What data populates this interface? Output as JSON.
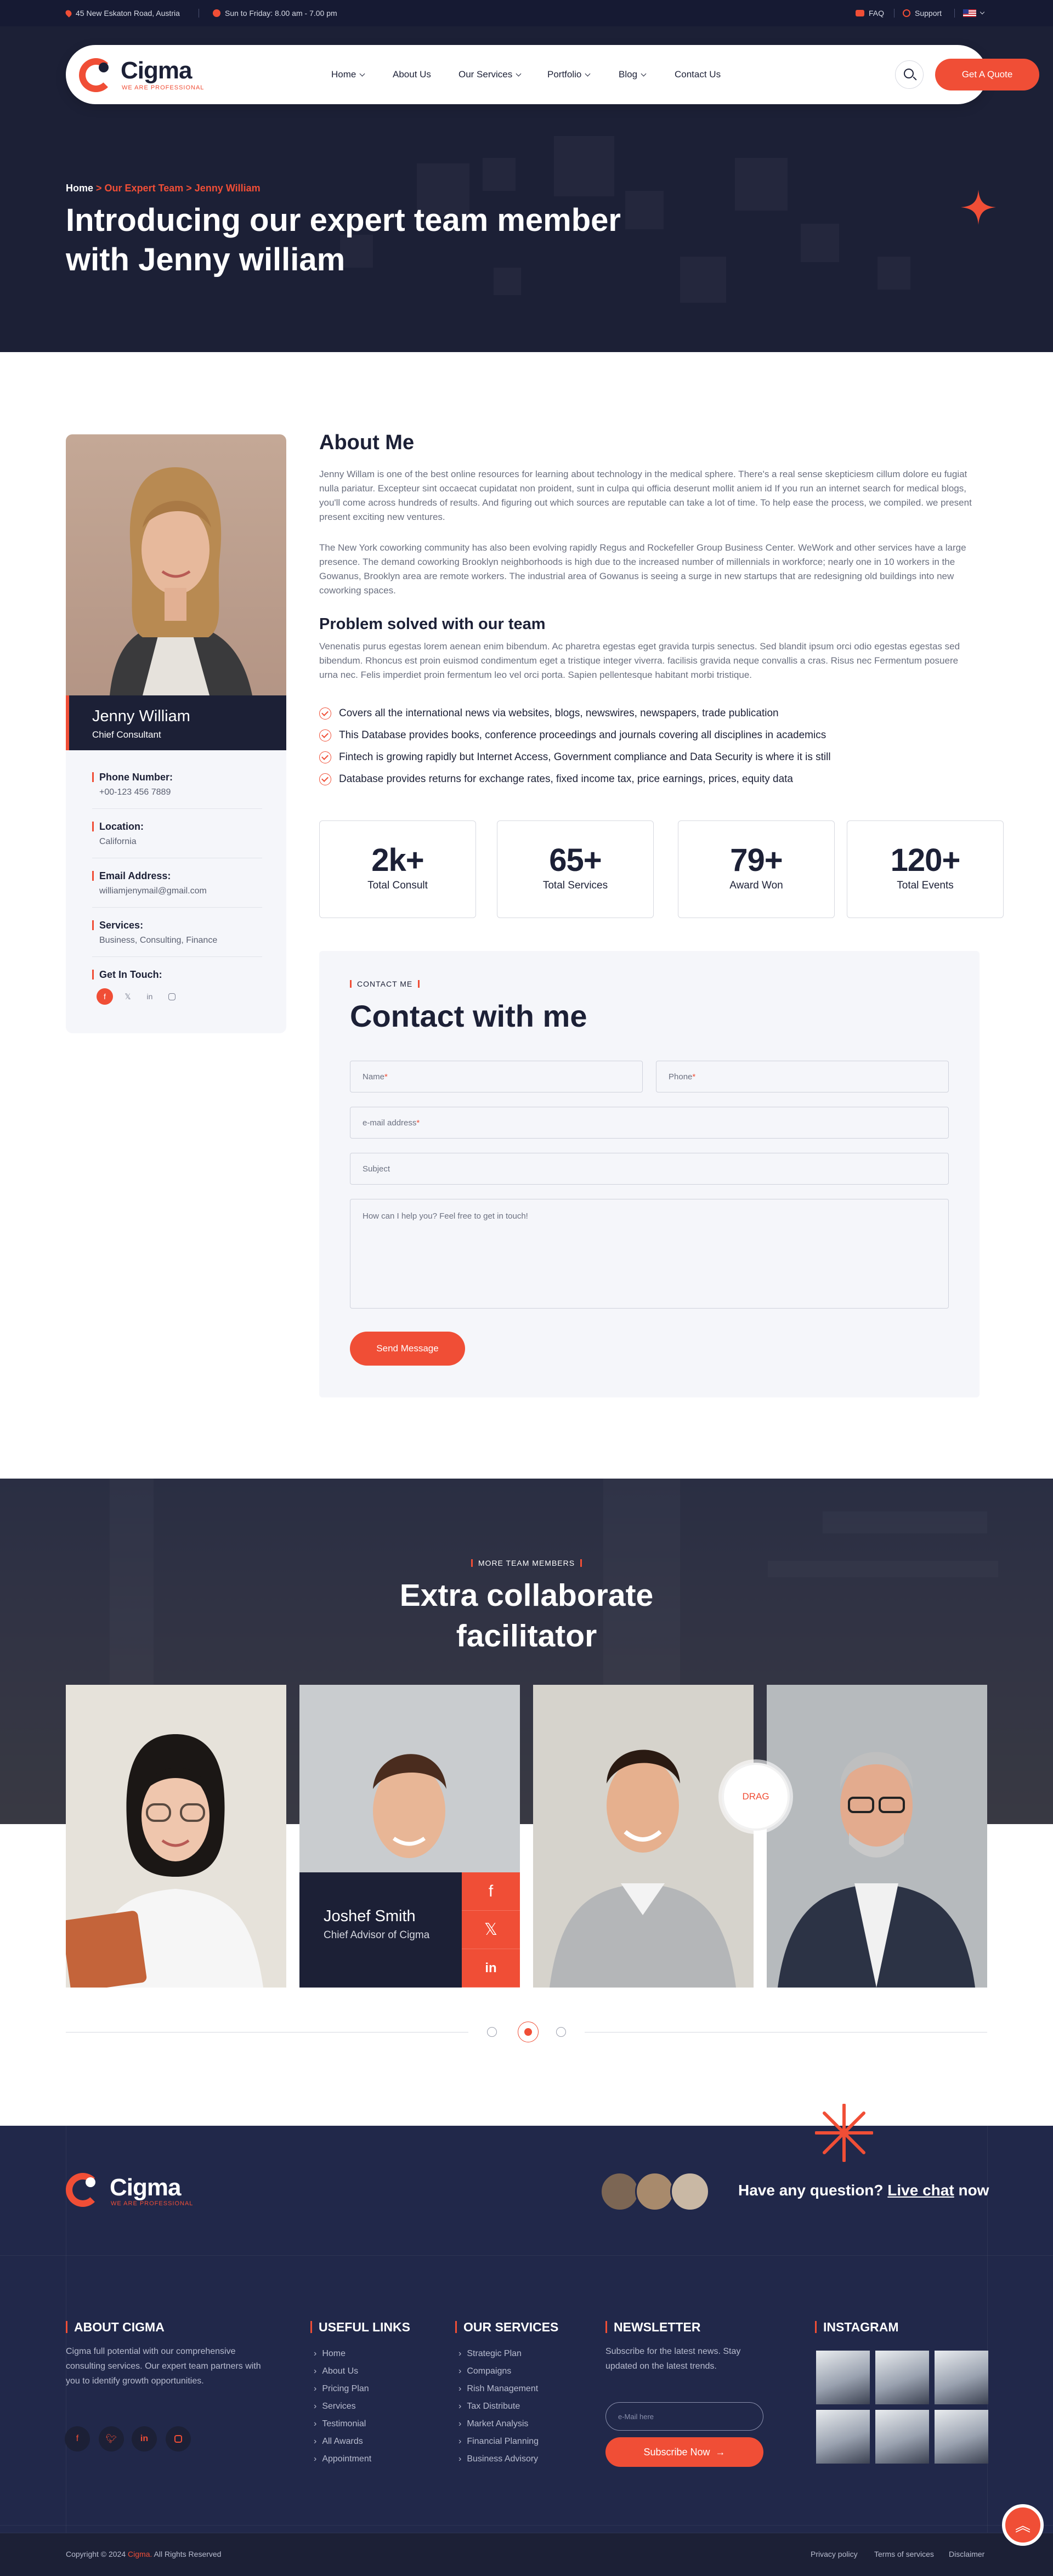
{
  "topbar": {
    "address": "45 New Eskaton Road, Austria",
    "hours": "Sun to Friday: 8.00 am - 7.00 pm",
    "faq": "FAQ",
    "support": "Support"
  },
  "header": {
    "brand": "Cigma",
    "tagline": "WE ARE PROFESSIONAL",
    "menu": [
      {
        "label": "Home",
        "has_dropdown": true
      },
      {
        "label": "About Us",
        "has_dropdown": false
      },
      {
        "label": "Our Services",
        "has_dropdown": true
      },
      {
        "label": "Portfolio",
        "has_dropdown": true
      },
      {
        "label": "Blog",
        "has_dropdown": true
      },
      {
        "label": "Contact Us",
        "has_dropdown": false
      }
    ],
    "cta": "Get A Quote"
  },
  "hero": {
    "breadcrumb": [
      "Home",
      "Our Expert Team",
      "Jenny William"
    ],
    "title_line1": "Introducing our expert team member",
    "title_line2": "with Jenny william"
  },
  "profile": {
    "name": "Jenny William",
    "role": "Chief Consultant",
    "info": [
      {
        "label": "Phone Number:",
        "value": "+00-123 456 7889"
      },
      {
        "label": "Location:",
        "value": "California"
      },
      {
        "label": "Email Address:",
        "value": "williamjenymail@gmail.com"
      },
      {
        "label": "Services:",
        "value": "Business, Consulting, Finance"
      }
    ],
    "get_in_touch": "Get In Touch:",
    "socials": [
      "facebook-icon",
      "x-icon",
      "linkedin-icon",
      "instagram-icon"
    ]
  },
  "about": {
    "heading": "About Me",
    "p1": "Jenny Willam is one of the best online resources for learning about technology in the medical sphere. There's a real sense skepticiesm cillum dolore eu fugiat nulla pariatur. Excepteur sint occaecat cupidatat non proident, sunt in culpa qui officia deserunt mollit aniem id If you run an internet search for medical blogs, you'll come across hundreds of results. And figuring out which sources are reputable can take a lot of time. To help ease the process, we compiled. we present present exciting new ventures.",
    "p2": "The New York coworking community has also been evolving rapidly Regus and Rockefeller Group Business Center. WeWork and other services have a large presence. The demand coworking Brooklyn neighborhoods is high due to the increased number of millennials in workforce; nearly one in 10 workers in the Gowanus, Brooklyn area are remote workers. The industrial area of Gowanus is seeing a surge in new startups that are redesigning old buildings into new coworking spaces.",
    "problem_heading": "Problem solved with our team",
    "p3": "Venenatis purus egestas lorem aenean enim bibendum. Ac pharetra egestas eget gravida turpis senectus. Sed blandit ipsum orci odio egestas egestas sed bibendum. Rhoncus est proin euismod condimentum eget a tristique integer viverra. facilisis gravida neque convallis a cras. Risus nec Fermentum posuere urna nec. Felis imperdiet proin fermentum leo vel orci porta. Sapien pellentesque habitant morbi tristique.",
    "checks": [
      "Covers all the international news via websites, blogs, newswires, newspapers, trade publication",
      "This Database provides books, conference proceedings and journals covering all disciplines in academics",
      "Fintech is growing rapidly but Internet Access, Government compliance and Data Security is where it is still",
      "Database provides returns for exchange rates, fixed income tax, price earnings, prices, equity data"
    ]
  },
  "stats": [
    {
      "value": "2k+",
      "label": "Total Consult"
    },
    {
      "value": "65+",
      "label": "Total Services"
    },
    {
      "value": "79+",
      "label": "Award Won"
    },
    {
      "value": "120+",
      "label": "Total Events"
    }
  ],
  "contact": {
    "tag": "CONTACT ME",
    "title": "Contact with me",
    "name_ph": "Name",
    "phone_ph": "Phone",
    "email_ph": "e-mail address",
    "subject_ph": "Subject",
    "message_ph": "How can I help you? Feel free to get in touch!",
    "required_mark": "*",
    "submit": "Send Message"
  },
  "team": {
    "tag": "MORE TEAM MEMBERS",
    "title_line1": "Extra collaborate",
    "title_line2": "facilitator",
    "featured_name": "Joshef Smith",
    "featured_role": "Chief Advisor of Cigma",
    "drag": "DRAG"
  },
  "footer": {
    "brand": "Cigma",
    "tagline": "WE ARE PROFESSIONAL",
    "question_text": "Have any question?",
    "live_chat": "Live chat",
    "question_tail": "now",
    "about_heading": "ABOUT CIGMA",
    "about_text": "Cigma full potential with our comprehensive consulting services. Our expert team partners with you to identify growth opportunities.",
    "useful_heading": "USEFUL LINKS",
    "useful_links": [
      "Home",
      "About Us",
      "Pricing Plan",
      "Services",
      "Testimonial",
      "All Awards",
      "Appointment"
    ],
    "services_heading": "OUR SERVICES",
    "services_links": [
      "Strategic Plan",
      "Compaigns",
      "Rish Management",
      "Tax Distribute",
      "Market Analysis",
      "Financial Planning",
      "Business Advisory"
    ],
    "newsletter_heading": "NEWSLETTER",
    "newsletter_text": "Subscribe for the latest news. Stay updated on the latest trends.",
    "email_ph": "e-Mail here",
    "subscribe": "Subscribe Now",
    "instagram_heading": "INSTAGRAM",
    "copyright_pre": "Copyright © 2024",
    "copyright_brand": "Cigma.",
    "copyright_post": "All Rights Reserved",
    "bottom_links": [
      "Privacy policy",
      "Terms of services",
      "Disclaimer"
    ]
  },
  "colors": {
    "accent": "#f04e36",
    "navy": "#1c2036",
    "footer": "#21284a"
  }
}
